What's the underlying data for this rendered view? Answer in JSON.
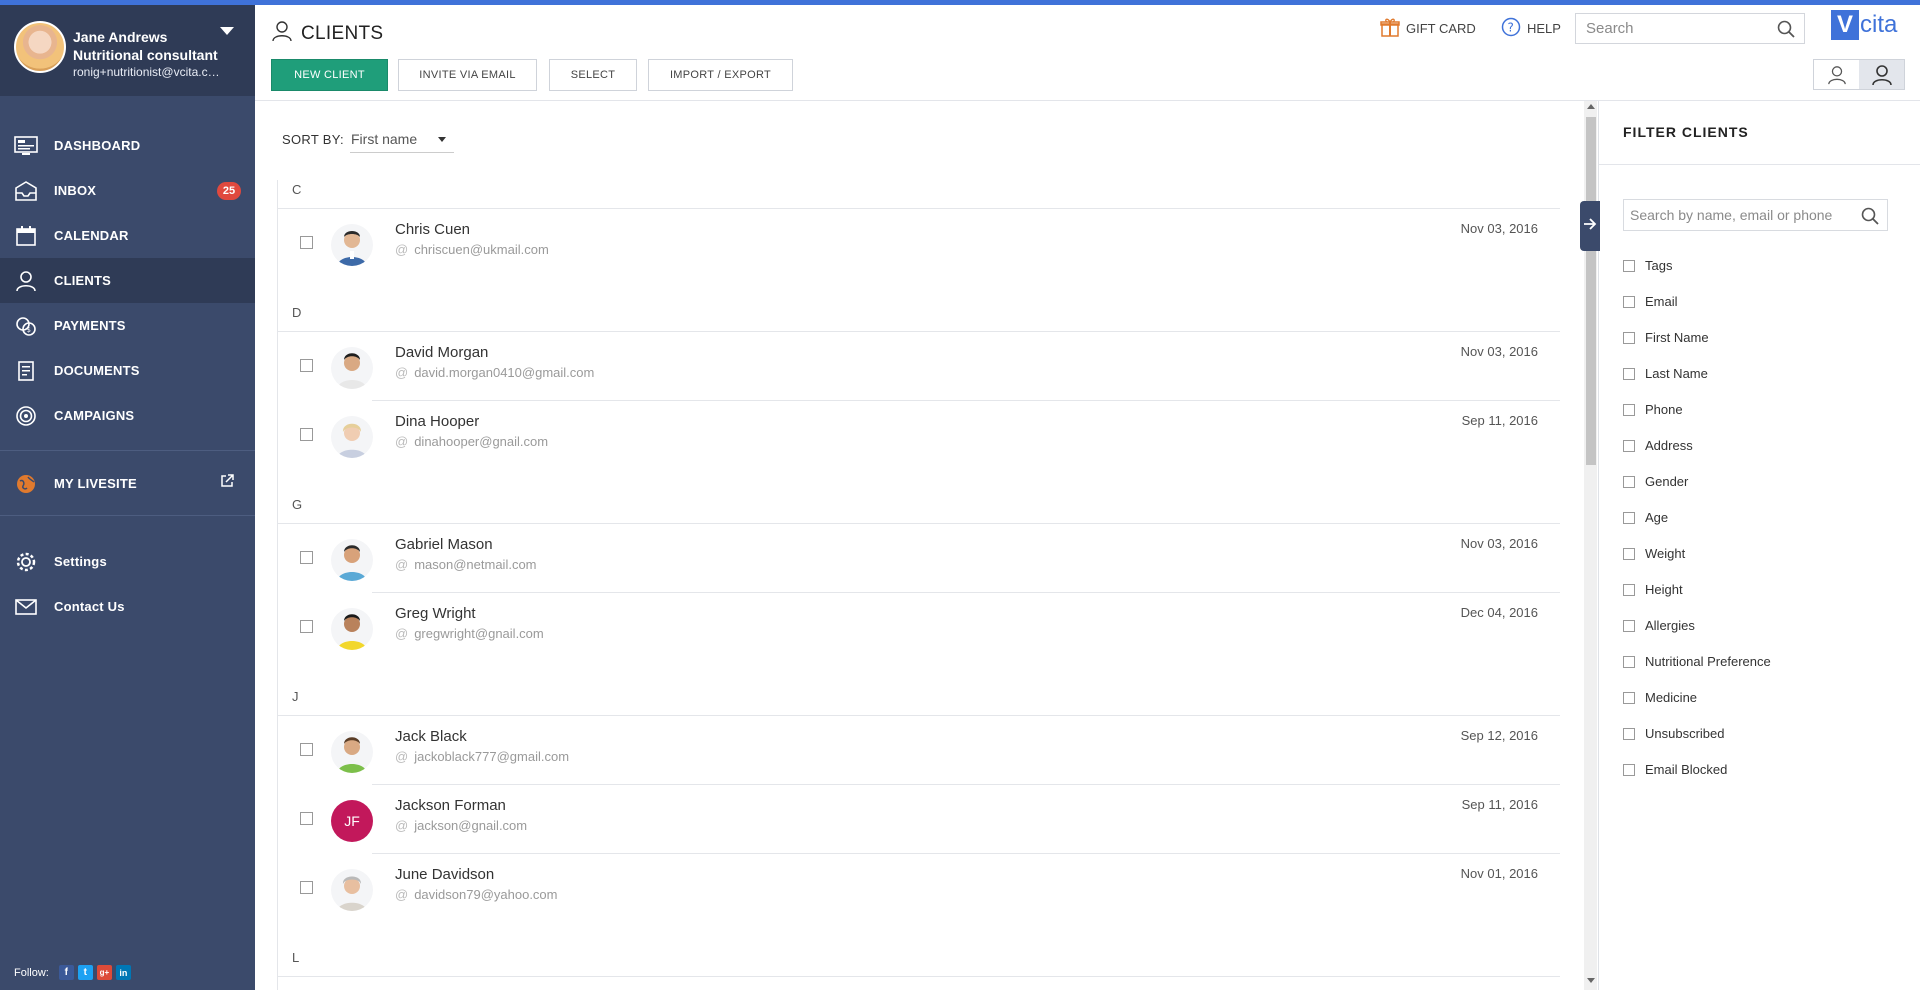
{
  "profile": {
    "name": "Jane Andrews",
    "role": "Nutritional consultant",
    "email": "ronig+nutritionist@vcita.co..."
  },
  "sidebar": {
    "items": [
      {
        "label": "DASHBOARD",
        "icon": "dashboard-icon"
      },
      {
        "label": "INBOX",
        "icon": "inbox-icon",
        "badge": "25"
      },
      {
        "label": "CALENDAR",
        "icon": "calendar-icon"
      },
      {
        "label": "CLIENTS",
        "icon": "clients-icon",
        "active": true
      },
      {
        "label": "PAYMENTS",
        "icon": "payments-icon"
      },
      {
        "label": "DOCUMENTS",
        "icon": "documents-icon"
      },
      {
        "label": "CAMPAIGNS",
        "icon": "campaigns-icon"
      },
      {
        "label": "MY LIVESITE",
        "icon": "globe-icon"
      },
      {
        "label": "Settings",
        "icon": "gear-icon"
      },
      {
        "label": "Contact Us",
        "icon": "envelope-icon"
      }
    ],
    "follow_label": "Follow:",
    "social": [
      "f",
      "t",
      "g+",
      "in"
    ]
  },
  "header": {
    "title": "CLIENTS",
    "buttons": {
      "new_client": "NEW CLIENT",
      "invite": "INVITE VIA EMAIL",
      "select": "SELECT",
      "import_export": "IMPORT / EXPORT"
    },
    "gift_card": "GIFT CARD",
    "help": "HELP",
    "search_placeholder": "Search",
    "logo_v": "V",
    "logo_text": "cita"
  },
  "sort": {
    "label": "SORT BY:",
    "value": "First name"
  },
  "clients": {
    "groups": [
      {
        "letter": "C"
      },
      {
        "letter": "D"
      },
      {
        "letter": "G"
      },
      {
        "letter": "J"
      },
      {
        "letter": "L"
      }
    ],
    "rows": [
      {
        "name": "Chris Cuen",
        "email": "chriscuen@ukmail.com",
        "date": "Nov 03, 2016"
      },
      {
        "name": "David Morgan",
        "email": "david.morgan0410@gmail.com",
        "date": "Nov 03, 2016"
      },
      {
        "name": "Dina Hooper",
        "email": "dinahooper@gnail.com",
        "date": "Sep 11, 2016"
      },
      {
        "name": "Gabriel Mason",
        "email": "mason@netmail.com",
        "date": "Nov 03, 2016"
      },
      {
        "name": "Greg Wright",
        "email": "gregwright@gnail.com",
        "date": "Dec 04, 2016"
      },
      {
        "name": "Jack Black",
        "email": "jackoblack777@gmail.com",
        "date": "Sep 12, 2016"
      },
      {
        "name": "Jackson Forman",
        "email": "jackson@gnail.com",
        "date": "Sep 11, 2016",
        "initials": "JF"
      },
      {
        "name": "June Davidson",
        "email": "davidson79@yahoo.com",
        "date": "Nov 01, 2016"
      }
    ]
  },
  "filter": {
    "title": "FILTER CLIENTS",
    "search_placeholder": "Search by name, email or phone",
    "items": [
      "Tags",
      "Email",
      "First Name",
      "Last Name",
      "Phone",
      "Address",
      "Gender",
      "Age",
      "Weight",
      "Height",
      "Allergies",
      "Nutritional Preference",
      "Medicine",
      "Unsubscribed",
      "Email Blocked"
    ]
  },
  "colors": {
    "accent": "#3f72d9",
    "sidebar": "#3b4a6b",
    "primary_button": "#1f9e7a",
    "badge": "#e0493e"
  }
}
